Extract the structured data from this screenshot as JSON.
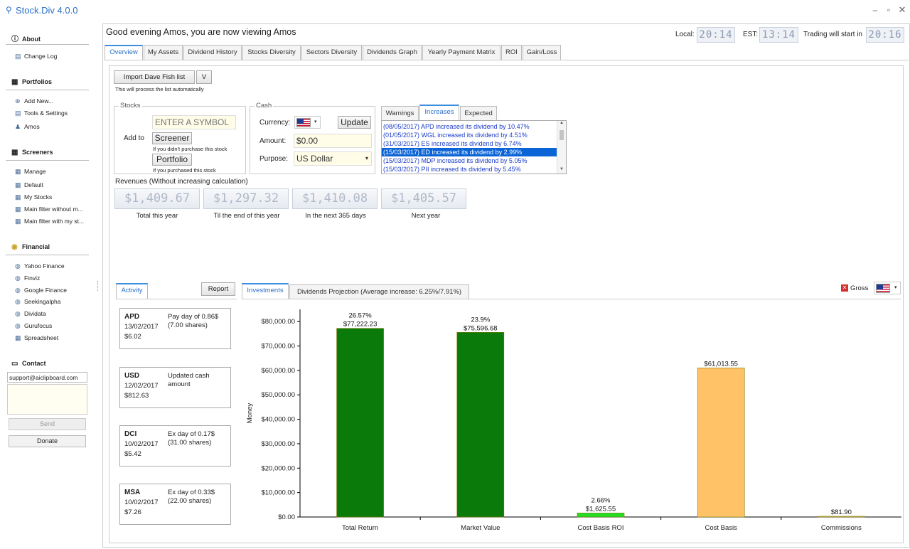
{
  "app": {
    "title": "Stock.Div 4.0.0"
  },
  "sidebar": {
    "about": {
      "title": "About",
      "items": [
        "Change Log"
      ]
    },
    "portfolios": {
      "title": "Portfolios",
      "items": [
        "Add New...",
        "Tools & Settings",
        "Amos"
      ]
    },
    "screeners": {
      "title": "Screeners",
      "items": [
        "Manage",
        "Default",
        "My Stocks",
        "Main filter without m...",
        "Main filter with my st..."
      ]
    },
    "financial": {
      "title": "Financial",
      "items": [
        "Yahoo Finance",
        "Finviz",
        "Google Finance",
        "Seekingalpha",
        "Dividata",
        "Gurufocus",
        "Spreadsheet"
      ]
    },
    "contact": {
      "title": "Contact",
      "email": "support@aiclipboard.com",
      "send": "Send",
      "donate": "Donate"
    }
  },
  "header": {
    "greeting": "Good evening Amos, you are now viewing Amos",
    "local_label": "Local:",
    "local_time": "20:14",
    "est_label": "EST:",
    "est_time": "13:14",
    "trading_label": "Trading will start in",
    "trading_time": "20:16"
  },
  "tabs": [
    "Overview",
    "My Assets",
    "Dividend History",
    "Stocks Diversity",
    "Sectors Diversity",
    "Dividends Graph",
    "Yearly Payment Matrix",
    "ROI",
    "Gain/Loss"
  ],
  "overview": {
    "import_btn": "Import Dave Fish list",
    "v_btn": "V",
    "import_note": "This will process the list automatically",
    "stocks": {
      "title": "Stocks",
      "add_to": "Add to",
      "symbol_placeholder": "ENTER A SYMBOL",
      "screener_btn": "Screener",
      "screener_note": "If you didn't purchase this stock",
      "portfolio_btn": "Portfolio",
      "portfolio_note": "If you purchased this stock"
    },
    "cash": {
      "title": "Cash",
      "currency_label": "Currency:",
      "update_btn": "Update",
      "amount_label": "Amount:",
      "amount_value": "$0.00",
      "purpose_label": "Purpose:",
      "purpose_value": "US Dollar"
    },
    "info_tabs": [
      "Warnings",
      "Increases",
      "Expected"
    ],
    "increases": [
      "(08/05/2017) APD increased its dividend by 10.47%",
      "(01/05/2017) WGL increased its dividend by 4.51%",
      "(31/03/2017) ES increased its dividend by 6.74%",
      "(15/03/2017) ED increased its dividend by 2.99%",
      "(15/03/2017) MDP increased its dividend by 5.05%",
      "(15/03/2017) PII increased its dividend by 5.45%"
    ],
    "revenues_title": "Revenues (Without increasing calculation)",
    "revenues": [
      {
        "value": "$1,409.67",
        "label": "Total this year"
      },
      {
        "value": "$1,297.32",
        "label": "Til the end of this year"
      },
      {
        "value": "$1,410.08",
        "label": "In the next 365 days"
      },
      {
        "value": "$1,405.57",
        "label": "Next year"
      }
    ]
  },
  "activity": {
    "tab": "Activity",
    "report_btn": "Report",
    "cards": [
      {
        "symbol": "APD",
        "date": "13/02/2017",
        "amount": "$6.02",
        "desc": "Pay day of 0.86$ (7.00 shares)"
      },
      {
        "symbol": "USD",
        "date": "12/02/2017",
        "amount": "$812.63",
        "desc": "Updated cash amount"
      },
      {
        "symbol": "DCI",
        "date": "10/02/2017",
        "amount": "$5.42",
        "desc": "Ex day of 0.17$ (31.00 shares)"
      },
      {
        "symbol": "MSA",
        "date": "10/02/2017",
        "amount": "$7.26",
        "desc": "Ex day of 0.33$ (22.00 shares)"
      }
    ]
  },
  "investments": {
    "tabs": [
      "Investments",
      "Dividends Projection (Average increase: 6.25%/7.91%)"
    ],
    "gross_label": "Gross"
  },
  "chart_data": {
    "type": "bar",
    "ylabel": "Money",
    "ylim": [
      0,
      85000
    ],
    "yticks": [
      "$0.00",
      "$10,000.00",
      "$20,000.00",
      "$30,000.00",
      "$40,000.00",
      "$50,000.00",
      "$60,000.00",
      "$70,000.00",
      "$80,000.00"
    ],
    "categories": [
      "Total Return",
      "Market Value",
      "Cost Basis ROI",
      "Cost Basis",
      "Commissions"
    ],
    "values": [
      77222.23,
      75596.68,
      1625.55,
      61013.55,
      81.9
    ],
    "value_labels": [
      "$77,222.23",
      "$75,596.68",
      "$1,625.55",
      "$61,013.55",
      "$81.90"
    ],
    "pct_labels": [
      "26.57%",
      "23.9%",
      "2.66%",
      "",
      ""
    ],
    "colors": [
      "#0a7a0a",
      "#0a7a0a",
      "#22dd22",
      "#ffc266",
      "#ffc266"
    ],
    "grid": false
  }
}
